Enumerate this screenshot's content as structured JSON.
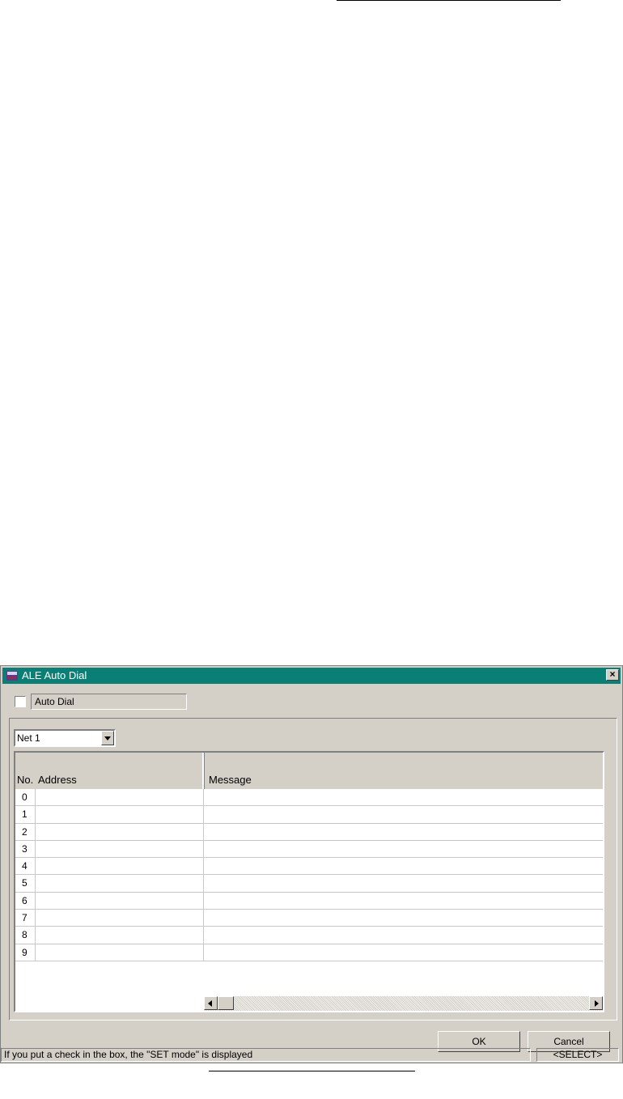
{
  "window": {
    "title": "ALE Auto Dial",
    "close_glyph": "×",
    "app_icon": "radio-app-icon",
    "titlebar_color": "#0a7f76"
  },
  "auto_dial": {
    "label": "Auto Dial",
    "checked": false
  },
  "net_select": {
    "value": "Net 1"
  },
  "table": {
    "columns": {
      "no": "No.",
      "address": "Address",
      "message": "Message"
    },
    "rows": [
      {
        "no": "0",
        "address": "",
        "message": ""
      },
      {
        "no": "1",
        "address": "",
        "message": ""
      },
      {
        "no": "2",
        "address": "",
        "message": ""
      },
      {
        "no": "3",
        "address": "",
        "message": ""
      },
      {
        "no": "4",
        "address": "",
        "message": ""
      },
      {
        "no": "5",
        "address": "",
        "message": ""
      },
      {
        "no": "6",
        "address": "",
        "message": ""
      },
      {
        "no": "7",
        "address": "",
        "message": ""
      },
      {
        "no": "8",
        "address": "",
        "message": ""
      },
      {
        "no": "9",
        "address": "",
        "message": ""
      }
    ]
  },
  "buttons": {
    "ok": "OK",
    "cancel": "Cancel"
  },
  "status_bar": {
    "message": "If you put a check in the box, the \"SET mode\" is displayed",
    "mode": "<SELECT>"
  }
}
